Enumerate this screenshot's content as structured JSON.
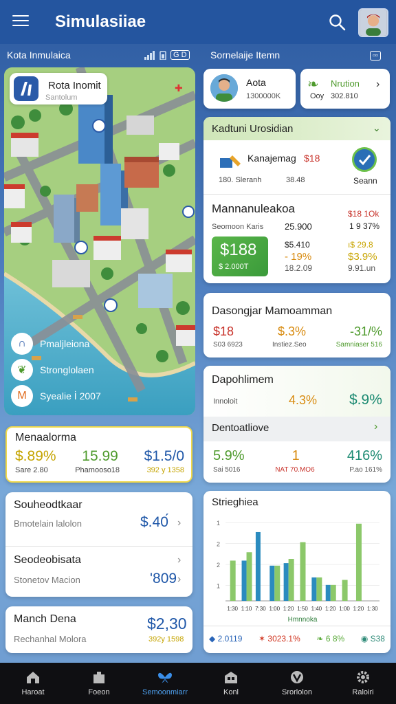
{
  "app": {
    "title": "Simulasiiae"
  },
  "left_panel": {
    "label": "Kota Inmulaica",
    "status": "G D",
    "map": {
      "header_title": "Rota Inomit",
      "header_sub": "Santolum",
      "legend": [
        {
          "label": "Pmaljleiona",
          "icon": "map-pin-icon"
        },
        {
          "label": "Stronglolaen",
          "icon": "leaf-icon"
        },
        {
          "label": "Syealie İ 2007",
          "icon": "factory-icon"
        }
      ]
    },
    "card1": {
      "title": "Menaalorma",
      "values": [
        "$.89%",
        "15.99",
        "$1.5/0"
      ],
      "subs": [
        "Sare 2.80",
        "Phamooso18",
        "392 y 1358"
      ]
    },
    "card2": {
      "title": "Souheodtkaar",
      "sub": "Bmotelain lalolon",
      "value": "$.40́"
    },
    "card3": {
      "title": "Seodeobisata",
      "sub": "Stonetov Macion",
      "value": "'809"
    },
    "card4": {
      "title": "Manch Dena",
      "sub": "Rechanhal Molora",
      "value": "$2,30",
      "value2": "392y 1598"
    }
  },
  "right_panel": {
    "label": "Sornelaije Itemn",
    "profile": {
      "name": "Aota",
      "sub": "1300000K"
    },
    "nation": {
      "name": "Nrution",
      "sub1": "Ooy",
      "sub2": "302.810"
    },
    "kadtuni": {
      "title": "Kadtuni Urosidian",
      "item_name": "Kanajemag",
      "item_price": "$18",
      "item_sub1": "180. Sleranh",
      "item_sub2": "38.48",
      "item_sub3": "Seann"
    },
    "manna": {
      "title": "Mannanuleakoa",
      "right_top": "$18 1Ok",
      "sub_left": "Seomoon Karis",
      "sub_mid": "25.900",
      "sub_right": "1 9 37%",
      "tag_value": "$188",
      "tag_sub": "$ 2.000T",
      "col1": [
        "$5.410",
        "- 19%",
        "18.2.09"
      ],
      "col2": [
        "ı$ 29.8",
        "$3.9%",
        "9.91.un"
      ]
    },
    "dasong": {
      "title": "Dasongjar Mamoamman",
      "values": [
        "$18",
        "$.3%",
        "-31/%"
      ],
      "subs": [
        "S03 6923",
        "Instiez.Seo",
        "Samniaser 516"
      ]
    },
    "dapoh": {
      "title": "Dapohlimem",
      "sub": "Innoloit",
      "values": [
        "4.3%",
        "$.9%"
      ]
    },
    "dento": {
      "title": "Dentoatliove",
      "values": [
        "5.9%",
        "1",
        "416%"
      ],
      "subs": [
        "Sai 5016",
        "NAT 70.MO6",
        "P.ao 161%"
      ]
    },
    "chart": {
      "title": "Strieghiea",
      "x_title": "Hmnnoka",
      "legend": [
        "2.0119",
        "3023.1%",
        "6 8%",
        "S38"
      ],
      "legend_colors": [
        "#2a65b8",
        "#d0341f",
        "#5aaa3a",
        "#2f8b78"
      ]
    }
  },
  "chart_data": {
    "type": "bar",
    "categories": [
      "1:30",
      "1:10",
      "7:30",
      "1:00",
      "1:20",
      "1:50",
      "1:40",
      "1:20",
      "1:00",
      "1:20",
      "1:30"
    ],
    "series": [
      {
        "name": "blue",
        "values": [
          null,
          0.48,
          0.82,
          0.42,
          0.45,
          null,
          0.28,
          0.19,
          null,
          null,
          null
        ]
      },
      {
        "name": "green",
        "values": [
          0.48,
          0.58,
          null,
          0.42,
          0.5,
          0.7,
          0.28,
          0.19,
          0.25,
          0.92,
          null
        ]
      }
    ],
    "colors": {
      "blue": "#2b8bbf",
      "green": "#8cc86a"
    },
    "xlabel": "Hmnnoka",
    "y_ticks": [
      "1",
      "2",
      "2",
      "1"
    ]
  },
  "nav": [
    {
      "label": "Haroat",
      "icon": "home-icon"
    },
    {
      "label": "Foeon",
      "icon": "shop-icon"
    },
    {
      "label": "Semoonmiarr",
      "icon": "butterfly-icon"
    },
    {
      "label": "Konl",
      "icon": "building-icon"
    },
    {
      "label": "Srorlolon",
      "icon": "check-icon"
    },
    {
      "label": "Raloiri",
      "icon": "gear-icon"
    }
  ]
}
